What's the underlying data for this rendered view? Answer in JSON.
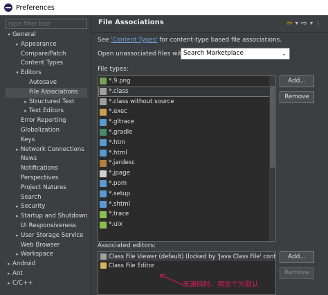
{
  "window": {
    "title": "Preferences"
  },
  "sidebar": {
    "filter_placeholder": "type filter text",
    "items": [
      {
        "label": "General",
        "level": 0,
        "expanded": true
      },
      {
        "label": "Appearance",
        "level": 1,
        "expandable": true
      },
      {
        "label": "Compare/Patch",
        "level": 1
      },
      {
        "label": "Content Types",
        "level": 1
      },
      {
        "label": "Editors",
        "level": 1,
        "expanded": true
      },
      {
        "label": "Autosave",
        "level": 2
      },
      {
        "label": "File Associations",
        "level": 2,
        "selected": true
      },
      {
        "label": "Structured Text",
        "level": 2,
        "expandable": true
      },
      {
        "label": "Text Editors",
        "level": 2,
        "expandable": true
      },
      {
        "label": "Error Reporting",
        "level": 1
      },
      {
        "label": "Globalization",
        "level": 1
      },
      {
        "label": "Keys",
        "level": 1
      },
      {
        "label": "Network Connections",
        "level": 1,
        "expandable": true
      },
      {
        "label": "News",
        "level": 1
      },
      {
        "label": "Notifications",
        "level": 1
      },
      {
        "label": "Perspectives",
        "level": 1
      },
      {
        "label": "Project Natures",
        "level": 1
      },
      {
        "label": "Search",
        "level": 1
      },
      {
        "label": "Security",
        "level": 1,
        "expandable": true
      },
      {
        "label": "Startup and Shutdown",
        "level": 1,
        "expandable": true
      },
      {
        "label": "UI Responsiveness",
        "level": 1
      },
      {
        "label": "User Storage Service",
        "level": 1,
        "expandable": true
      },
      {
        "label": "Web Browser",
        "level": 1
      },
      {
        "label": "Workspace",
        "level": 1,
        "expandable": true
      },
      {
        "label": "Android",
        "level": 0,
        "expandable": true
      },
      {
        "label": "Ant",
        "level": 0,
        "expandable": true
      },
      {
        "label": "C/C++",
        "level": 0,
        "expandable": true
      }
    ]
  },
  "main": {
    "title": "File Associations",
    "see_prefix": "See ",
    "see_link": "'Content Types'",
    "see_suffix": " for content-type based file associations.",
    "open_unassociated_label": "Open unassociated files with:",
    "open_unassociated_value": "Search Marketplace",
    "file_types_label": "File types:",
    "file_types": [
      {
        "label": "*.9.png",
        "icon_color": "#7aa05a"
      },
      {
        "label": "*.class",
        "icon_color": "#a0a0a0",
        "selected": true
      },
      {
        "label": "*.class without source",
        "icon_color": "#a0a0a0"
      },
      {
        "label": "*.exec",
        "icon_color": "#c8a050"
      },
      {
        "label": "*.gltrace",
        "icon_color": "#5a9ad0"
      },
      {
        "label": "*.gradle",
        "icon_color": "#4a8a6a"
      },
      {
        "label": "*.htm",
        "icon_color": "#5a9ad0"
      },
      {
        "label": "*.html",
        "icon_color": "#5a9ad0"
      },
      {
        "label": "*.jardesc",
        "icon_color": "#b08040"
      },
      {
        "label": "*.jpage",
        "icon_color": "#d0d0d0"
      },
      {
        "label": "*.pom",
        "icon_color": "#5a9ad0"
      },
      {
        "label": "*.setup",
        "icon_color": "#5a9ad0"
      },
      {
        "label": "*.shtml",
        "icon_color": "#5a9ad0"
      },
      {
        "label": "*.trace",
        "icon_color": "#8ac050"
      },
      {
        "label": "*.uix",
        "icon_color": "#8ac050"
      }
    ],
    "add_label": "Add...",
    "remove_label": "Remove",
    "associated_editors_label": "Associated editors:",
    "editors": [
      {
        "label": "Class File Viewer (default) (locked by 'Java Class File' content",
        "selected": true
      },
      {
        "label": "Class File Editor"
      }
    ],
    "editor_add_label": "Add...",
    "editor_remove_label": "Remove",
    "watermark": "无源码时，用这个为默认"
  }
}
